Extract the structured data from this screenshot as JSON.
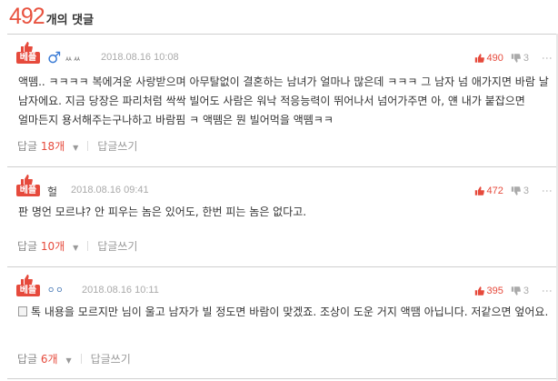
{
  "header": {
    "count": "492",
    "suffix": "개의 댓글"
  },
  "badge_label": "베플",
  "comments": [
    {
      "author": "ㅆㅆ",
      "date": "2018.08.16 10:08",
      "up": "490",
      "down": "3",
      "text": "액뗌.. ㅋㅋㅋㅋ 복에겨운 사랑받으며 아무탈없이 결혼하는 남녀가 얼마나 많은데 ㅋㅋㅋ 그 남자 넘 애가지면 바람 날 남자에요. 지금 당장은 파리처럼 싹싹 빌어도 사람은 워낙 적응능력이 뛰어나서 넘어가주면 아, 얜 내가 붙잡으면 얼마든지 용서해주는구나하고 바람핌 ㅋ 액뗌은 뭔 빌어먹을 액뗌ㅋㅋ",
      "replies_label": "답글",
      "replies_count": "18개",
      "write_label": "답글쓰기"
    },
    {
      "author": "헐",
      "date": "2018.08.16 09:41",
      "up": "472",
      "down": "3",
      "text": "판 명언 모르냐? 안 피우는 놈은 있어도, 한번 피는 놈은 없다고.",
      "replies_label": "답글",
      "replies_count": "10개",
      "write_label": "답글쓰기"
    },
    {
      "author": "ㅇㅇ",
      "date": "2018.08.16 10:11",
      "up": "395",
      "down": "3",
      "text": "톡 내용을 모르지만 님이 울고 남자가 빌 정도면 바람이 맞겠죠. 조상이 도운 거지 액땜 아닙니다. 저같으면 엎어요.",
      "replies_label": "답글",
      "replies_count": "6개",
      "write_label": "답글쓰기"
    }
  ]
}
